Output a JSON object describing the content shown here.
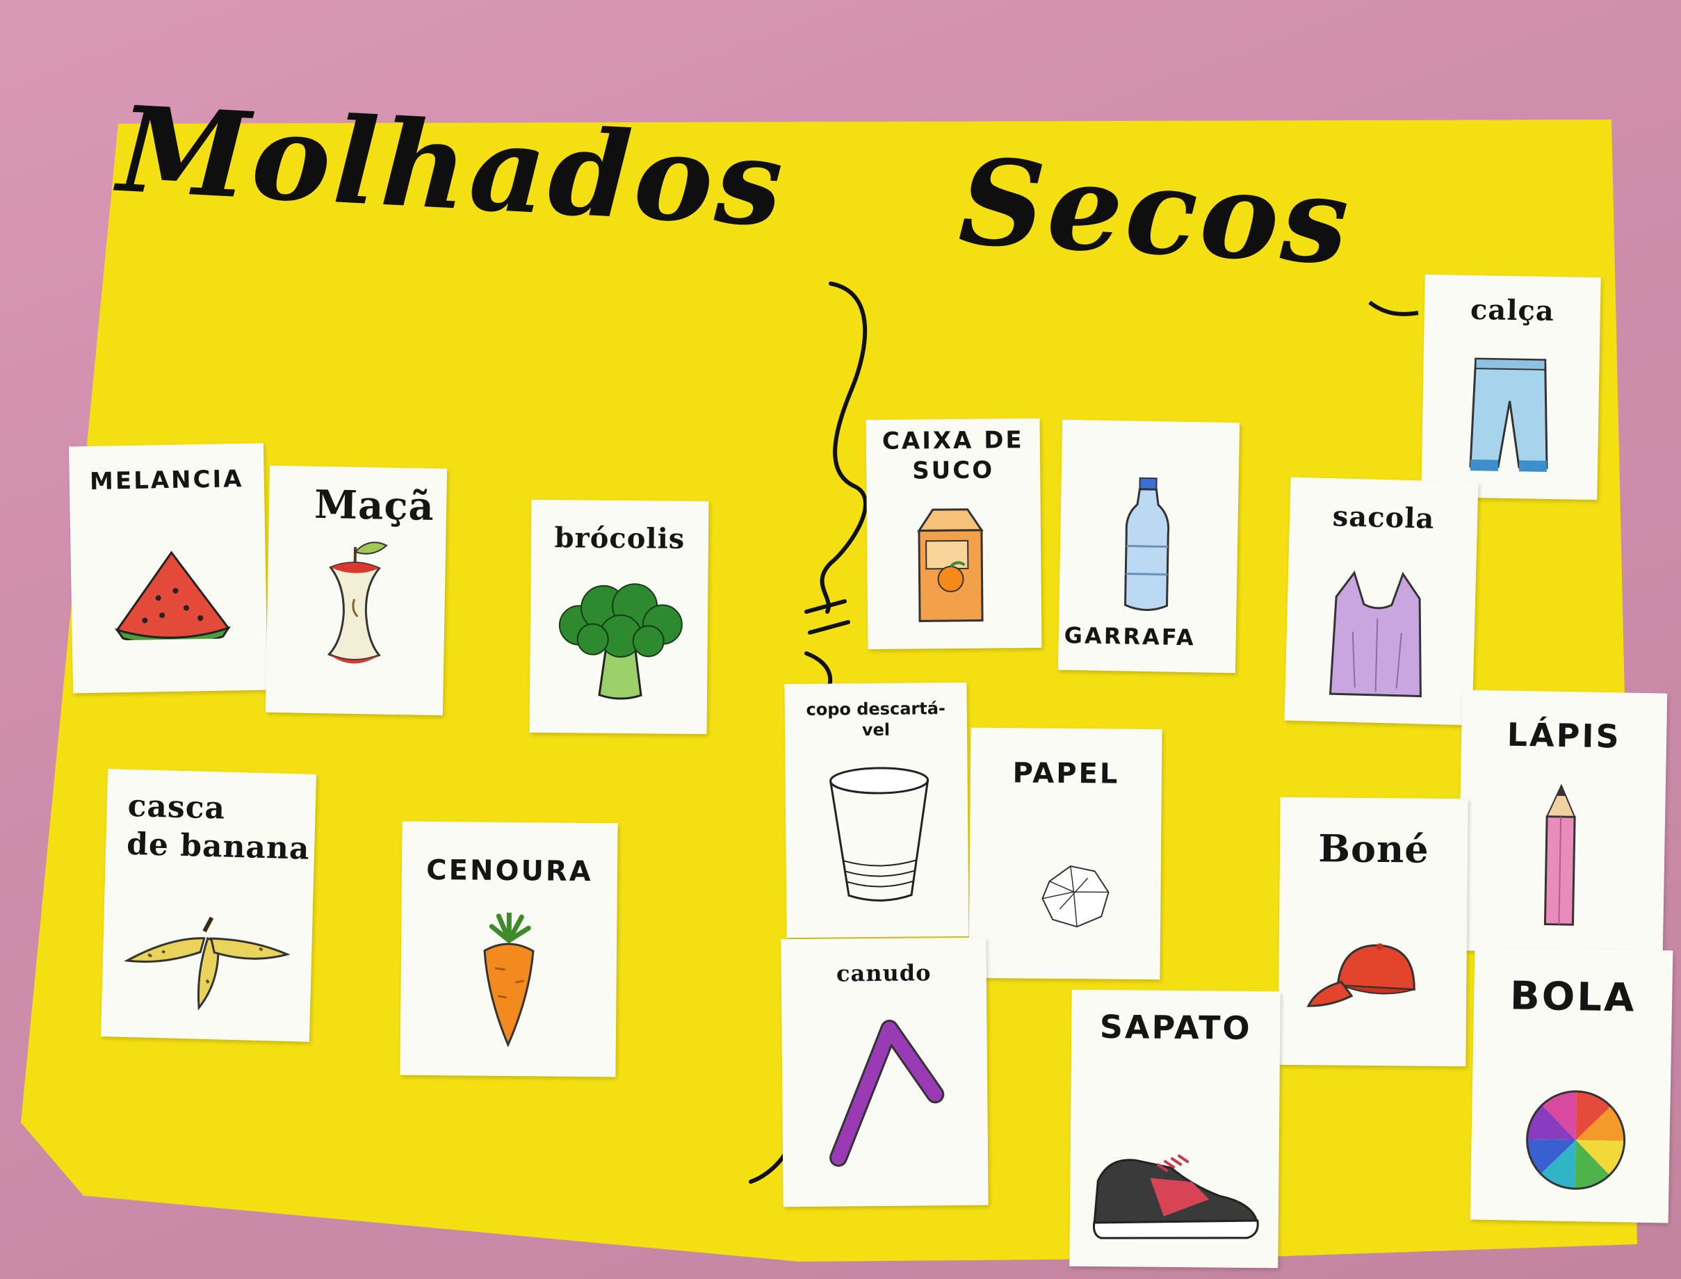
{
  "poster": {
    "background_color": "#f3df12",
    "wall_color": "#d195b1",
    "left_title": "Molhados",
    "right_title": "Secos"
  },
  "cards": {
    "melancia": {
      "label": "MELANCIA",
      "icon": "watermelon-slice-icon"
    },
    "maca": {
      "label": "Maçã",
      "icon": "apple-core-icon"
    },
    "brocolis": {
      "label": "brócolis",
      "icon": "broccoli-icon"
    },
    "casca_banana": {
      "label": "casca\nde banana",
      "icon": "banana-peel-icon"
    },
    "cenoura": {
      "label": "CENOURA",
      "icon": "carrot-icon"
    },
    "caixa_suco": {
      "label": "CAIXA DE\nSUCO",
      "icon": "juice-box-icon"
    },
    "garrafa": {
      "label": "GARRAFA",
      "icon": "plastic-bottle-icon"
    },
    "calca": {
      "label": "calça",
      "icon": "jeans-icon"
    },
    "sacola": {
      "label": "sacola",
      "icon": "plastic-bag-icon"
    },
    "copo": {
      "label": "copo descartá-\nvel",
      "icon": "disposable-cup-icon"
    },
    "papel": {
      "label": "PAPEL",
      "icon": "crumpled-paper-icon"
    },
    "lapis": {
      "label": "LÁPIS",
      "icon": "pencil-icon"
    },
    "bone": {
      "label": "Boné",
      "icon": "cap-icon"
    },
    "canudo": {
      "label": "canudo",
      "icon": "straw-icon"
    },
    "sapato": {
      "label": "SAPATO",
      "icon": "sneaker-icon"
    },
    "bola": {
      "label": "BOLA",
      "icon": "ball-icon"
    }
  }
}
